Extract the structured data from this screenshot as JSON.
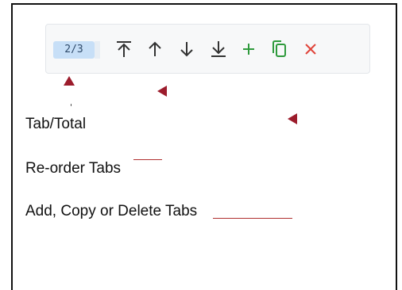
{
  "toolbar": {
    "counter": "2/3",
    "buttons": [
      {
        "name": "move-to-top-button",
        "icon": "arrow-to-top-icon",
        "color": "#333333"
      },
      {
        "name": "move-up-button",
        "icon": "arrow-up-icon",
        "color": "#333333"
      },
      {
        "name": "move-down-button",
        "icon": "arrow-down-icon",
        "color": "#333333"
      },
      {
        "name": "move-to-bottom-button",
        "icon": "arrow-to-bottom-icon",
        "color": "#333333"
      },
      {
        "name": "add-tab-button",
        "icon": "plus-icon",
        "color": "#2e9a3c"
      },
      {
        "name": "copy-tab-button",
        "icon": "copy-icon",
        "color": "#2e9a3c"
      },
      {
        "name": "delete-tab-button",
        "icon": "close-icon",
        "color": "#e0443a"
      }
    ]
  },
  "annotations": {
    "tab_total": "Tab/Total",
    "reorder": "Re-order Tabs",
    "add_copy_delete": "Add, Copy or Delete Tabs",
    "marker_color": "#9c1c2c"
  }
}
